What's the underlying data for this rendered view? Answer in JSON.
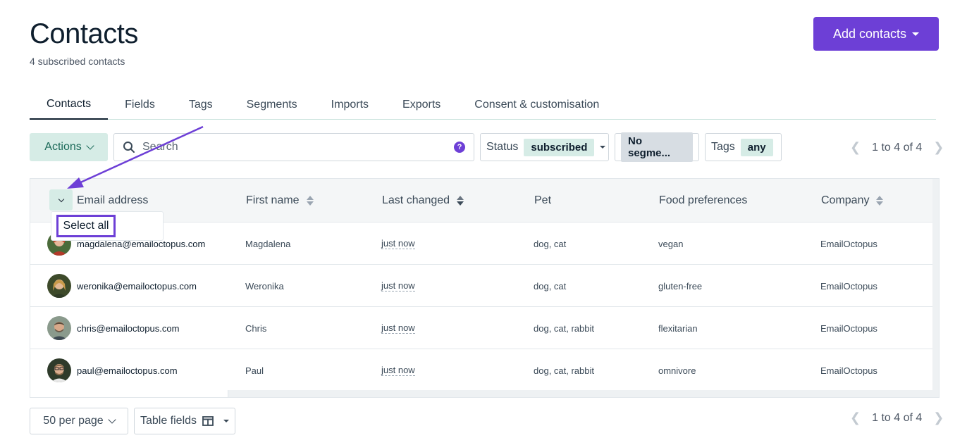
{
  "header": {
    "title": "Contacts",
    "subtitle": "4 subscribed contacts",
    "add_button": "Add contacts"
  },
  "tabs": [
    {
      "label": "Contacts",
      "active": true
    },
    {
      "label": "Fields"
    },
    {
      "label": "Tags"
    },
    {
      "label": "Segments"
    },
    {
      "label": "Imports"
    },
    {
      "label": "Exports"
    },
    {
      "label": "Consent & customisation"
    }
  ],
  "toolbar": {
    "actions_label": "Actions",
    "search_placeholder": "Search",
    "help_glyph": "?",
    "status_label": "Status",
    "status_value": "subscribed",
    "segment_value": "No segme...",
    "tags_label": "Tags",
    "tags_value": "any",
    "pagination": "1 to 4 of 4"
  },
  "table": {
    "columns": [
      "Email address",
      "First name",
      "Last changed",
      "Pet",
      "Food preferences",
      "Company"
    ],
    "select_all_label": "Select all",
    "rows": [
      {
        "email": "magdalena@emailoctopus.com",
        "first_name": "Magdalena",
        "last_changed": "just now",
        "pet": "dog, cat",
        "food": "vegan",
        "company": "EmailOctopus"
      },
      {
        "email": "weronika@emailoctopus.com",
        "first_name": "Weronika",
        "last_changed": "just now",
        "pet": "dog, cat",
        "food": "gluten-free",
        "company": "EmailOctopus"
      },
      {
        "email": "chris@emailoctopus.com",
        "first_name": "Chris",
        "last_changed": "just now",
        "pet": "dog, cat, rabbit",
        "food": "flexitarian",
        "company": "EmailOctopus"
      },
      {
        "email": "paul@emailoctopus.com",
        "first_name": "Paul",
        "last_changed": "just now",
        "pet": "dog, cat, rabbit",
        "food": "omnivore",
        "company": "EmailOctopus"
      }
    ]
  },
  "footer": {
    "per_page": "50 per page",
    "table_fields": "Table fields",
    "pagination": "1 to 4 of 4"
  },
  "colors": {
    "accent": "#6d3fd6",
    "chip": "#d6ece6",
    "header_bg": "#f4f6f7"
  }
}
